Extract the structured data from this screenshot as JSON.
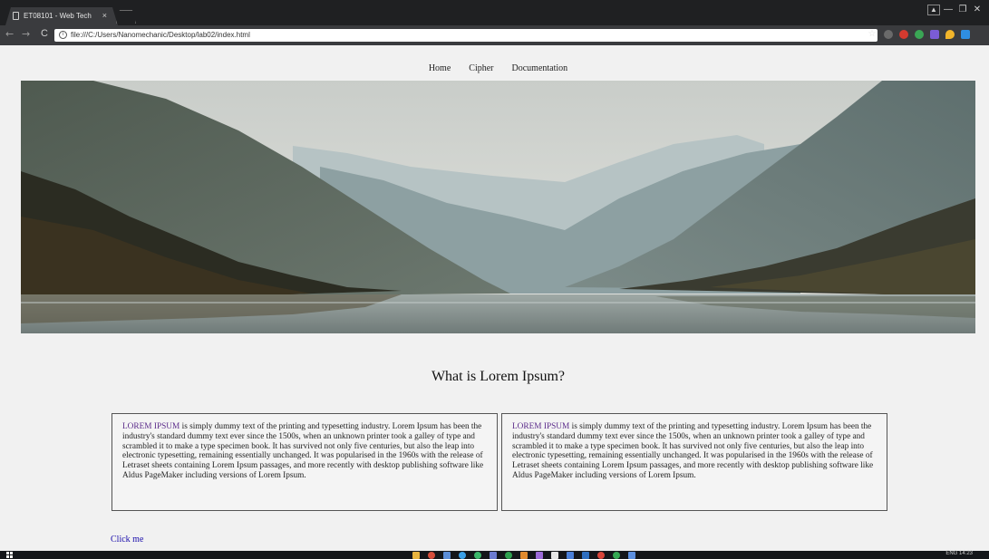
{
  "browser": {
    "tab_title": "ET08101 - Web Tech",
    "tab_close": "×",
    "url": "file:///C:/Users/Nanomechanic/Desktop/lab02/index.html",
    "back_glyph": "←",
    "forward_glyph": "→",
    "reload_glyph": "C",
    "bookmark_glyph": "☆",
    "minimize_glyph": "—",
    "restore_glyph": "❐",
    "close_glyph": "✕",
    "profile_glyph": "▲",
    "accent_color": "#3a3b3e"
  },
  "nav": {
    "items": [
      {
        "label": "Home"
      },
      {
        "label": "Cipher"
      },
      {
        "label": "Documentation"
      }
    ]
  },
  "main": {
    "heading": "What is Lorem Ipsum?",
    "cards": [
      {
        "lead": "LOREM IPSUM",
        "body": " is simply dummy text of the printing and typesetting industry. Lorem Ipsum has been the industry's standard dummy text ever since the 1500s, when an unknown printer took a galley of type and scrambled it to make a type specimen book. It has survived not only five centuries, but also the leap into electronic typesetting, remaining essentially unchanged. It was popularised in the 1960s with the release of Letraset sheets containing Lorem Ipsum passages, and more recently with desktop publishing software like Aldus PageMaker including versions of Lorem Ipsum."
      },
      {
        "lead": "LOREM IPSUM",
        "body": " is simply dummy text of the printing and typesetting industry. Lorem Ipsum has been the industry's standard dummy text ever since the 1500s, when an unknown printer took a galley of type and scrambled it to make a type specimen book. It has survived not only five centuries, but also the leap into electronic typesetting, remaining essentially unchanged. It was popularised in the 1960s with the release of Letraset sheets containing Lorem Ipsum passages, and more recently with desktop publishing software like Aldus PageMaker including versions of Lorem Ipsum."
      }
    ],
    "link_label": "Click me"
  },
  "taskbar": {
    "clock": "ENG 14:23"
  }
}
